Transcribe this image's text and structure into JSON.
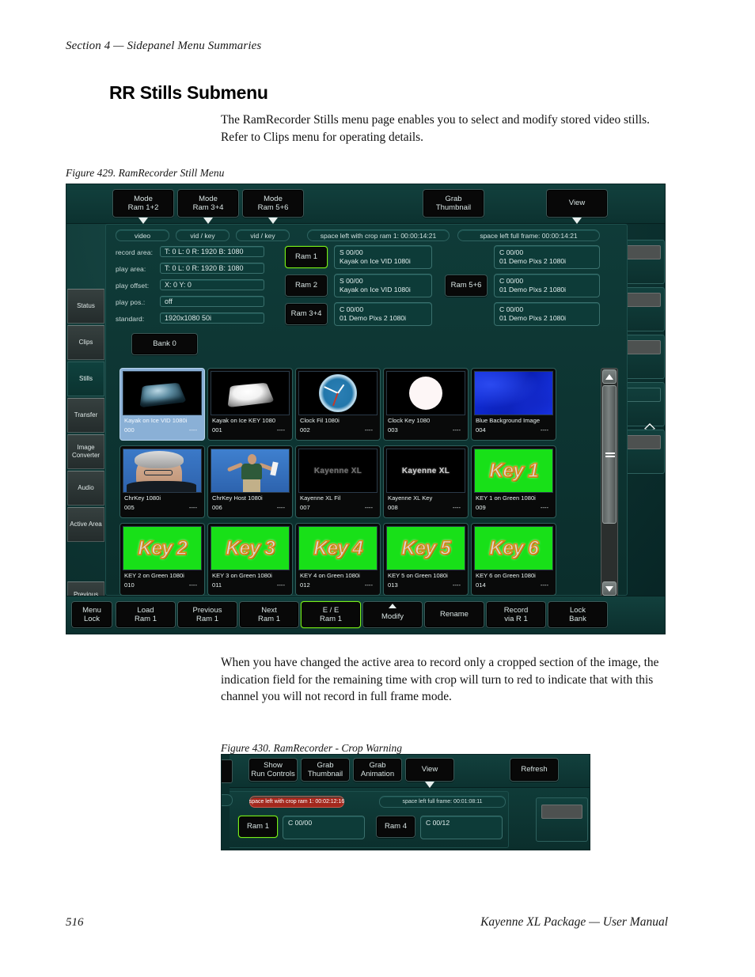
{
  "document": {
    "running_head": "Section 4 — Sidepanel Menu Summaries",
    "chapter_title": "RR Stills Submenu",
    "intro_paragraph": "The RamRecorder Stills menu page enables you to select and modify stored video stills. Refer to Clips menu for operating details.",
    "figure429_caption": "Figure 429.  RamRecorder Still Menu",
    "crop_paragraph": "When you have changed the active area to record only a cropped section of the image, the indication field for the remaining time with crop will turn to red to indicate that with this channel you will not record in full frame mode.",
    "figure430_caption": "Figure 430.  RamRecorder - Crop Warning",
    "page_number": "516",
    "footer_title": "Kayenne XL Package  —  User Manual"
  },
  "colors": {
    "panel_background": "#0d3432",
    "panel_edge": "#1d4f4c",
    "button_face": "#080808",
    "button_lit_border": "#7aee18",
    "selected_thumb": "#8ab0d6",
    "alarm_red": "#a3281d",
    "chroma_green": "#18e018",
    "field_text": "#e3efee"
  },
  "fig429": {
    "top_buttons": [
      {
        "line1": "Mode",
        "line2": "Ram 1+2",
        "caret": true
      },
      {
        "line1": "Mode",
        "line2": "Ram 3+4",
        "caret": true
      },
      {
        "line1": "Mode",
        "line2": "Ram 5+6",
        "caret": true
      },
      {
        "line1": "Grab",
        "line2": "Thumbnail",
        "caret": false
      },
      {
        "line1": "View",
        "line2": "",
        "caret": true
      }
    ],
    "status_pills": [
      {
        "text": "video",
        "alarm": false
      },
      {
        "text": "vid / key",
        "alarm": false
      },
      {
        "text": "vid / key",
        "alarm": false
      },
      {
        "text": "space left with crop ram 1: 00:00:14:21",
        "alarm": false
      },
      {
        "text": "space left full frame: 00:00:14:21",
        "alarm": false
      }
    ],
    "parameters": [
      {
        "label": "record area:",
        "value": "T: 0  L: 0  R: 1920  B: 1080"
      },
      {
        "label": "play area:",
        "value": "T: 0  L: 0  R: 1920  B: 1080"
      },
      {
        "label": "play offset:",
        "value": "X: 0  Y: 0"
      },
      {
        "label": "play pos.:",
        "value": "off"
      },
      {
        "label": "standard:",
        "value": "1920x1080 50i"
      }
    ],
    "bank_button": "Bank 0",
    "ram_buttons": [
      {
        "label": "Ram 1",
        "lit": true
      },
      {
        "label": "Ram 2",
        "lit": false
      },
      {
        "label": "Ram 3+4",
        "lit": false
      },
      {
        "label": "Ram 5+6",
        "lit": false
      }
    ],
    "ram_status_left": [
      {
        "line1": "S 00/00",
        "line2": "Kayak on Ice VID 1080i"
      },
      {
        "line1": "S 00/00",
        "line2": "Kayak on Ice VID 1080i"
      },
      {
        "line1": "C 00/00",
        "line2": "01 Demo Pixs 2 1080i"
      }
    ],
    "ram_status_right": [
      {
        "line1": "C 00/00",
        "line2": "01 Demo Pixs 2 1080i"
      },
      {
        "line1": "C 00/00",
        "line2": "01 Demo Pixs 2 1080i"
      },
      {
        "line1": "C 00/00",
        "line2": "01 Demo Pixs 2 1080i"
      }
    ],
    "sidebar": [
      {
        "label": "Status",
        "active": false
      },
      {
        "label": "Clips",
        "active": false
      },
      {
        "label": "Stills",
        "active": true
      },
      {
        "label": "Transfer",
        "active": false
      },
      {
        "label": "Image Converter",
        "active": false
      },
      {
        "label": "Audio",
        "active": false
      },
      {
        "label": "Active Area",
        "active": false
      },
      {
        "label": "Previous Menu",
        "active": false
      }
    ],
    "thumbnails": [
      {
        "name": "Kayak on Ice VID 1080i",
        "index": "000",
        "dashes": "----",
        "art": "kayak-vid",
        "selected": true
      },
      {
        "name": "Kayak on Ice KEY 1080",
        "index": "001",
        "dashes": "----",
        "art": "kayak-key",
        "selected": false
      },
      {
        "name": "Clock Fil 1080i",
        "index": "002",
        "dashes": "----",
        "art": "clock",
        "selected": false
      },
      {
        "name": "Clock Key 1080",
        "index": "003",
        "dashes": "----",
        "art": "circle",
        "selected": false
      },
      {
        "name": "Blue Background Image",
        "index": "004",
        "dashes": "----",
        "art": "blue",
        "selected": false
      },
      {
        "name": "ChrKey  1080i",
        "index": "005",
        "dashes": "----",
        "art": "chrkey",
        "selected": false
      },
      {
        "name": "ChrKey Host 1080i",
        "index": "006",
        "dashes": "----",
        "art": "host",
        "selected": false
      },
      {
        "name": "Kayenne XL Fil",
        "index": "007",
        "dashes": "----",
        "art": "kay-fill",
        "selected": false,
        "wordmark": "Kayenne XL"
      },
      {
        "name": "Kayenne XL Key",
        "index": "008",
        "dashes": "----",
        "art": "kay-key",
        "selected": false,
        "wordmark": "Kayenne XL"
      },
      {
        "name": "KEY 1 on Green 1080i",
        "index": "009",
        "dashes": "----",
        "art": "key-green",
        "selected": false,
        "keytext": "Key 1"
      },
      {
        "name": "KEY 2 on Green 1080i",
        "index": "010",
        "dashes": "----",
        "art": "key-green",
        "selected": false,
        "keytext": "Key 2"
      },
      {
        "name": "KEY 3 on Green 1080i",
        "index": "011",
        "dashes": "----",
        "art": "key-green",
        "selected": false,
        "keytext": "Key 3"
      },
      {
        "name": "KEY 4 on Green 1080i",
        "index": "012",
        "dashes": "----",
        "art": "key-green",
        "selected": false,
        "keytext": "Key 4"
      },
      {
        "name": "KEY 5 on Green 1080i",
        "index": "013",
        "dashes": "----",
        "art": "key-green",
        "selected": false,
        "keytext": "Key 5"
      },
      {
        "name": "KEY 6 on Green 1080i",
        "index": "014",
        "dashes": "----",
        "art": "key-green",
        "selected": false,
        "keytext": "Key 6"
      }
    ],
    "bottom_buttons": [
      {
        "line1": "Menu",
        "line2": "Lock",
        "lit": false,
        "caret_up": false
      },
      {
        "line1": "Load",
        "line2": "Ram 1",
        "lit": false,
        "caret_up": false
      },
      {
        "line1": "Previous",
        "line2": "Ram 1",
        "lit": false,
        "caret_up": false
      },
      {
        "line1": "Next",
        "line2": "Ram 1",
        "lit": false,
        "caret_up": false
      },
      {
        "line1": "E / E",
        "line2": "Ram 1",
        "lit": true,
        "caret_up": false
      },
      {
        "line1": "Modify",
        "line2": "",
        "lit": false,
        "caret_up": true
      },
      {
        "line1": "Rename",
        "line2": "",
        "lit": false,
        "caret_up": false
      },
      {
        "line1": "Record",
        "line2": "via R 1",
        "lit": false,
        "caret_up": false
      },
      {
        "line1": "Lock",
        "line2": "Bank",
        "lit": false,
        "caret_up": false
      }
    ],
    "scrollbar": {
      "up_arrow": "scroll-up",
      "down_arrow": "scroll-down"
    }
  },
  "fig430": {
    "top_buttons": [
      {
        "line1": "Show",
        "line2": "Run Controls",
        "caret": false
      },
      {
        "line1": "Grab",
        "line2": "Thumbnail",
        "caret": false
      },
      {
        "line1": "Grab",
        "line2": "Animation",
        "caret": false
      },
      {
        "line1": "View",
        "line2": "",
        "caret": true
      },
      {
        "line1": "Refresh",
        "line2": "",
        "caret": false
      }
    ],
    "status_pills": [
      {
        "text": "space left with crop ram 1: 00:02:12:16",
        "alarm": true
      },
      {
        "text": "space left full frame: 00:01:08:11",
        "alarm": false
      }
    ],
    "ram_buttons": [
      {
        "label": "Ram 1",
        "lit": true
      },
      {
        "label": "Ram 4",
        "lit": false
      }
    ],
    "ram_status": [
      {
        "line1": "C 00/00",
        "line2": ""
      },
      {
        "line1": "C 00/12",
        "line2": ""
      }
    ]
  }
}
